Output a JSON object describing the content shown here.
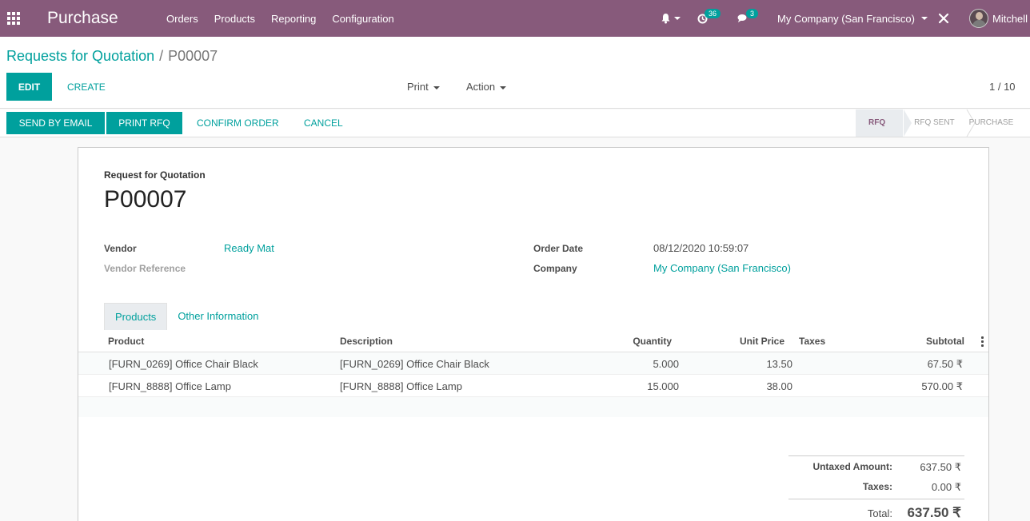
{
  "navbar": {
    "app_name": "Purchase",
    "menu": [
      "Orders",
      "Products",
      "Reporting",
      "Configuration"
    ],
    "activity_count": "36",
    "messages_count": "3",
    "company": "My Company (San Francisco)",
    "user": "Mitchell"
  },
  "breadcrumb": {
    "parent": "Requests for Quotation",
    "separator": "/",
    "current": "P00007"
  },
  "control": {
    "edit_label": "EDIT",
    "create_label": "CREATE",
    "print_label": "Print",
    "action_label": "Action",
    "pager": "1 / 10"
  },
  "statusbar": {
    "buttons": [
      "SEND BY EMAIL",
      "PRINT RFQ",
      "CONFIRM ORDER",
      "CANCEL"
    ],
    "stages": [
      "RFQ",
      "RFQ SENT",
      "PURCHASE"
    ]
  },
  "form": {
    "doc_label": "Request for Quotation",
    "doc_name": "P00007",
    "vendor_label": "Vendor",
    "vendor": "Ready Mat",
    "vendor_ref_label": "Vendor Reference",
    "order_date_label": "Order Date",
    "order_date": "08/12/2020 10:59:07",
    "company_label": "Company",
    "company": "My Company (San Francisco)"
  },
  "tabs": [
    "Products",
    "Other Information"
  ],
  "table": {
    "headers": [
      "Product",
      "Description",
      "Quantity",
      "Unit Price",
      "Taxes",
      "Subtotal"
    ],
    "rows": [
      [
        "[FURN_0269] Office Chair Black",
        "[FURN_0269] Office Chair Black",
        "5.000",
        "13.50",
        "",
        "67.50 ₹"
      ],
      [
        "[FURN_8888] Office Lamp",
        "[FURN_8888] Office Lamp",
        "15.000",
        "38.00",
        "",
        "570.00 ₹"
      ]
    ]
  },
  "totals": {
    "untaxed_label": "Untaxed Amount:",
    "untaxed": "637.50 ₹",
    "taxes_label": "Taxes:",
    "taxes": "0.00 ₹",
    "total_label": "Total:",
    "total": "637.50 ₹"
  },
  "colors": {
    "brand": "#875a7b",
    "accent": "#00a09d"
  }
}
